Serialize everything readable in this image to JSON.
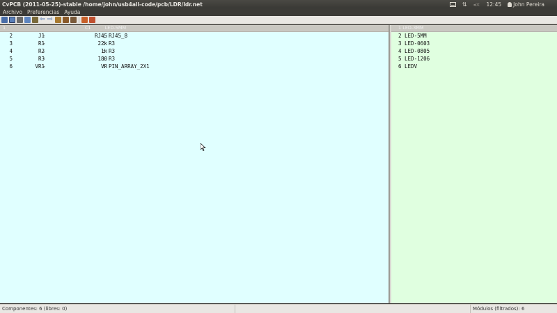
{
  "window": {
    "title": "CvPCB (2011-05-25)-stable /home/john/usb4all-code/pcb/LDR/ldr.net"
  },
  "tray": {
    "time": "12:45",
    "user": "John Pereira"
  },
  "menu": {
    "items": [
      "Archivo",
      "Preferencias",
      "Ayuda"
    ]
  },
  "toolbar": {
    "icons": [
      "open-netlist-icon",
      "save-icon",
      "config-icon",
      "module-view-icon",
      "library-icon",
      "previous-icon",
      "next-icon",
      "auto-associate-icon",
      "delete-associations-icon",
      "export-icon",
      "doc-icon",
      "help-icon"
    ],
    "colors": [
      "#4a6ea8",
      "#5a7fb8",
      "#6b6b6b",
      "#5f86c0",
      "#7a6a3a",
      "#3a64a8",
      "#3a64a8",
      "#a87a30",
      "#8a5a2a",
      "#7a5a3a",
      "#c8602a",
      "#c05030"
    ]
  },
  "components": {
    "header": [
      "1",
      "C1",
      "LED-5MM"
    ],
    "rows": [
      {
        "index": "2",
        "ref": "J1",
        "value": "RJ45",
        "footprint": "RJ45_8"
      },
      {
        "index": "3",
        "ref": "R1",
        "value": "22k",
        "footprint": "R3"
      },
      {
        "index": "4",
        "ref": "R2",
        "value": "1k",
        "footprint": "R3"
      },
      {
        "index": "5",
        "ref": "R3",
        "value": "180",
        "footprint": "R3"
      },
      {
        "index": "6",
        "ref": "VR1",
        "value": "VR",
        "footprint": "PIN_ARRAY_2X1"
      }
    ]
  },
  "footprints": {
    "header": "1 LED-3MM",
    "items": [
      "2 LED-5MM",
      "3 LED-0603",
      "4 LED-0805",
      "5 LED-1206",
      "6 LEDV"
    ]
  },
  "statusbar": {
    "components": "Componentes: 6 (libres: 0)",
    "middle": "",
    "modules": "Módulos (filtrados): 6"
  },
  "colors": {
    "left_pane": "#e0ffff",
    "right_pane": "#e0ffe0",
    "panel": "#3c3b37"
  }
}
